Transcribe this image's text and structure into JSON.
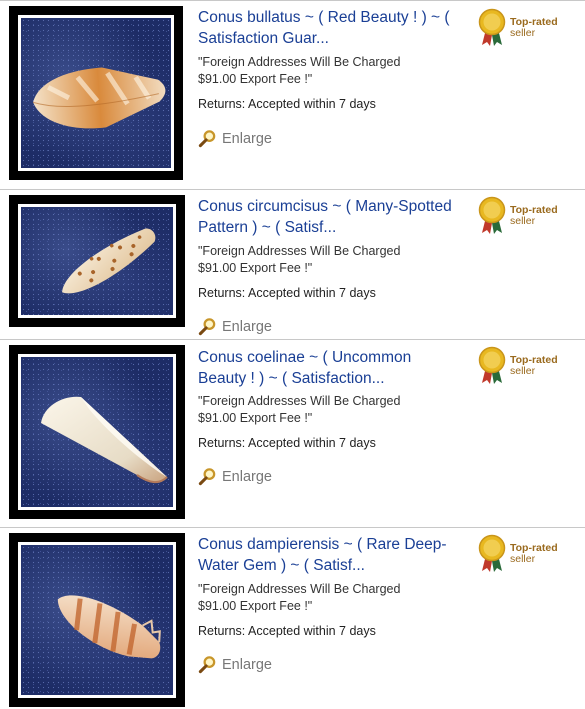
{
  "listings": [
    {
      "title": "Conus bullatus ~ ( Red Beauty ! ) ~ ( Satisfaction Guar...",
      "notice_line1": "\"Foreign Addresses Will Be Charged",
      "notice_line2": "$91.00 Export Fee !\"",
      "returns": "Returns: Accepted within 7 days",
      "enlarge": "Enlarge",
      "badge_line1": "Top-rated",
      "badge_line2": "seller"
    },
    {
      "title": "Conus circumcisus ~ ( Many-Spotted Pattern ) ~ ( Satisf...",
      "notice_line1": "\"Foreign Addresses Will Be Charged",
      "notice_line2": "$91.00 Export Fee !\"",
      "returns": "Returns: Accepted within 7 days",
      "enlarge": "Enlarge",
      "badge_line1": "Top-rated",
      "badge_line2": "seller"
    },
    {
      "title": "Conus coelinae ~ ( Uncommon Beauty ! ) ~ ( Satisfaction...",
      "notice_line1": "\"Foreign Addresses Will Be Charged",
      "notice_line2": "$91.00 Export Fee !\"",
      "returns": "Returns: Accepted within 7 days",
      "enlarge": "Enlarge",
      "badge_line1": "Top-rated",
      "badge_line2": "seller"
    },
    {
      "title": "Conus dampierensis ~ ( Rare Deep-Water Gem ) ~ ( Satisf...",
      "notice_line1": "\"Foreign Addresses Will Be Charged",
      "notice_line2": "$91.00 Export Fee !\"",
      "returns": "Returns: Accepted within 7 days",
      "enlarge": "Enlarge",
      "badge_line1": "Top-rated",
      "badge_line2": "seller"
    }
  ],
  "colors": {
    "title_link": "#1a3f95",
    "badge_gold": "#e8b820",
    "divider": "#c8c8c8"
  },
  "icons": {
    "enlarge": "magnifier-icon",
    "badge": "top-rated-medal-icon"
  }
}
